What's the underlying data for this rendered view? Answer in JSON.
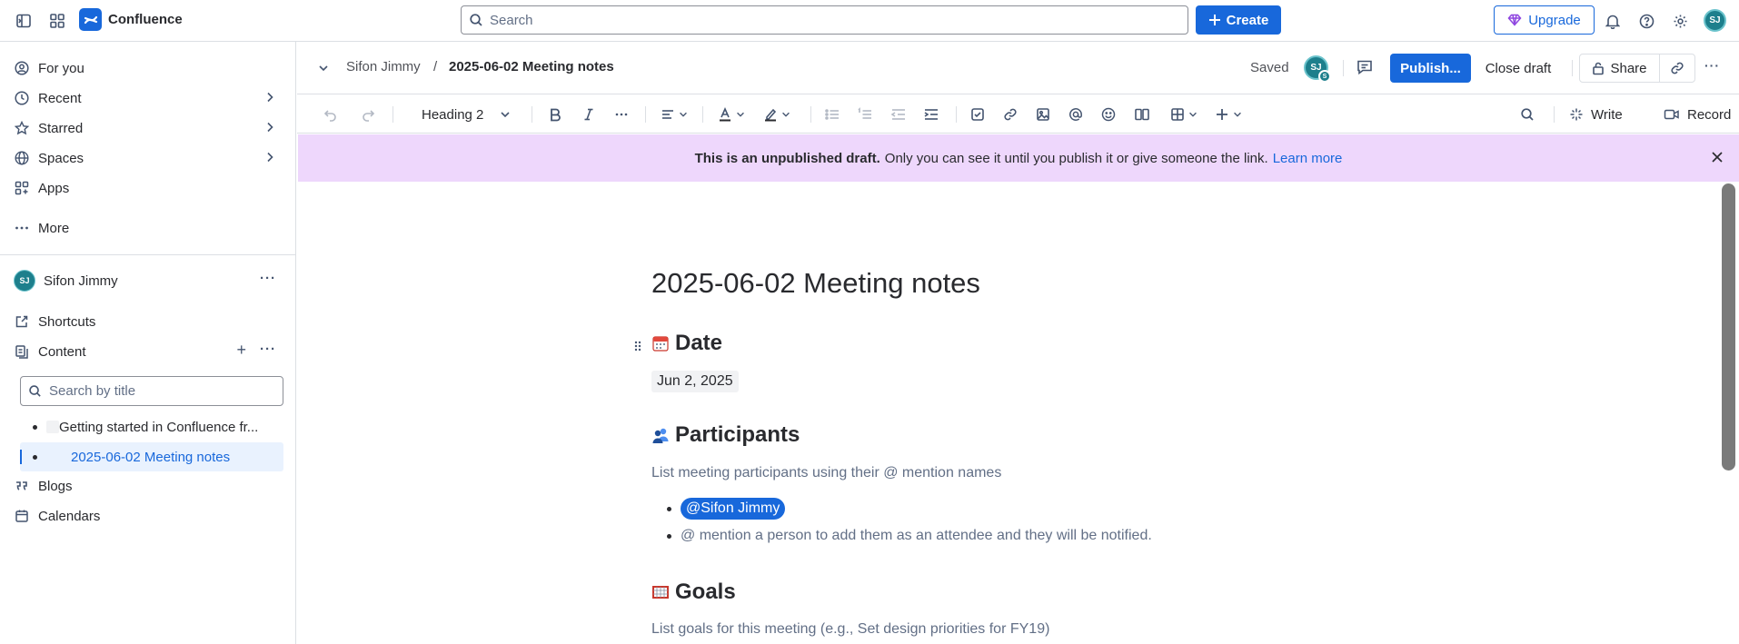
{
  "topbar": {
    "app_name": "Confluence",
    "search_placeholder": "Search",
    "create_label": "Create",
    "upgrade_label": "Upgrade",
    "user_initials": "SJ"
  },
  "sidebar": {
    "nav": [
      {
        "label": "For you"
      },
      {
        "label": "Recent"
      },
      {
        "label": "Starred"
      },
      {
        "label": "Spaces"
      },
      {
        "label": "Apps"
      },
      {
        "label": "More"
      }
    ],
    "space": {
      "name": "Sifon Jimmy",
      "initials": "SJ"
    },
    "shortcuts_label": "Shortcuts",
    "content_label": "Content",
    "title_search_placeholder": "Search by title",
    "tree": [
      {
        "label": "Getting started in Confluence fr..."
      },
      {
        "label": "2025-06-02 Meeting notes"
      }
    ],
    "blogs_label": "Blogs",
    "calendars_label": "Calendars"
  },
  "header": {
    "breadcrumb_space": "Sifon Jimmy",
    "breadcrumb_sep": "/",
    "breadcrumb_page": "2025-06-02 Meeting notes",
    "status": "Saved",
    "avatar_initials": "SJ",
    "avatar_sub": "S",
    "publish_label": "Publish...",
    "close_draft_label": "Close draft",
    "share_label": "Share"
  },
  "toolbar": {
    "text_style": "Heading 2",
    "write_label": "Write",
    "record_label": "Record"
  },
  "banner": {
    "bold_text": "This is an unpublished draft.",
    "text": "Only you can see it until you publish it or give someone the link.",
    "link": "Learn more"
  },
  "document": {
    "title": "2025-06-02 Meeting notes",
    "date_heading": "Date",
    "date_value": "Jun 2, 2025",
    "participants_heading": "Participants",
    "participants_hint": "List meeting participants using their @ mention names",
    "mention": "@Sifon Jimmy",
    "mention_hint": "@ mention a person to add them as an attendee and they will be notified.",
    "goals_heading": "Goals",
    "goals_hint": "List goals for this meeting (e.g., Set design priorities for FY19)"
  },
  "colors": {
    "brand": "#1868db",
    "banner": "#eed7fc",
    "avatar": "#1d7f8c"
  }
}
